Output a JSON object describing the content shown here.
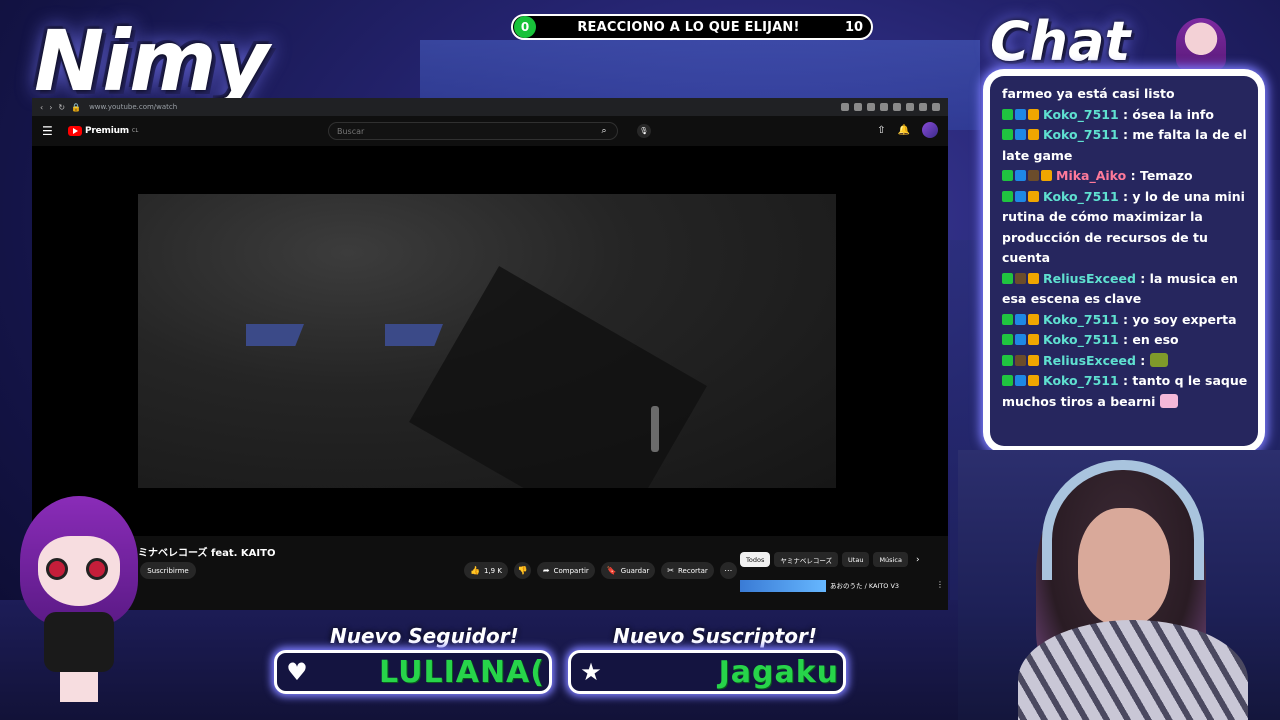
{
  "overlay": {
    "streamer_name": "Nimy",
    "chat_heading": "Chat",
    "goal": {
      "start": "0",
      "title": "REACCIONO A LO QUE ELIJAN!",
      "end": "10"
    },
    "alerts": {
      "follower_label": "Nuevo Seguidor!",
      "follower_name": "LULIANA(",
      "follower_icon": "heart-icon",
      "subscriber_label": "Nuevo Suscriptor!",
      "subscriber_name": "Jagaku",
      "subscriber_icon": "star-icon"
    }
  },
  "browser": {
    "url": "www.youtube.com/watch"
  },
  "youtube": {
    "logo": "Premium",
    "logo_badge": "CL",
    "search_placeholder": "Buscar",
    "video_title": "ミナベレコーズ feat. KAITO",
    "subscribe_label": "Suscribirme",
    "likes": "1,9 K",
    "share_label": "Compartir",
    "save_label": "Guardar",
    "clip_label": "Recortar",
    "chips": [
      "Todos",
      "ヤミナベレコーズ",
      "Utau",
      "Música"
    ],
    "rec_title": "あおのうた / KAITO V3"
  },
  "chat": {
    "messages": [
      {
        "user": "",
        "text": "farmeo ya está casi listo",
        "color": "#ffffff",
        "badges": []
      },
      {
        "user": "Koko_7511",
        "text": ": ósea la info",
        "color": "#5fe0d0",
        "badges": [
          "k",
          "blue",
          "gold"
        ]
      },
      {
        "user": "Koko_7511",
        "text": ": me falta la de el late game",
        "color": "#5fe0d0",
        "badges": [
          "k",
          "blue",
          "gold"
        ]
      },
      {
        "user": "Mika_Aiko",
        "text": ": Temazo",
        "color": "#ff7a9a",
        "badges": [
          "k",
          "blue",
          "dark",
          "gold"
        ]
      },
      {
        "user": "Koko_7511",
        "text": ": y lo de una mini rutina de cómo maximizar la producción de recursos de tu cuenta",
        "color": "#5fe0d0",
        "badges": [
          "k",
          "blue",
          "gold"
        ]
      },
      {
        "user": "ReliusExceed",
        "text": ": la musica en esa escena es clave",
        "color": "#5fe0d0",
        "badges": [
          "k",
          "dark",
          "gold"
        ]
      },
      {
        "user": "Koko_7511",
        "text": ": yo soy experta",
        "color": "#5fe0d0",
        "badges": [
          "k",
          "blue",
          "gold"
        ]
      },
      {
        "user": "Koko_7511",
        "text": ": en eso",
        "color": "#5fe0d0",
        "badges": [
          "k",
          "blue",
          "gold"
        ]
      },
      {
        "user": "ReliusExceed",
        "text": ":",
        "color": "#5fe0d0",
        "badges": [
          "k",
          "dark",
          "gold"
        ],
        "emote": "green"
      },
      {
        "user": "Koko_7511",
        "text": ": tanto q le saque muchos tiros a bearni",
        "color": "#5fe0d0",
        "badges": [
          "k",
          "blue",
          "gold"
        ],
        "emote": "pinkemote"
      }
    ]
  }
}
